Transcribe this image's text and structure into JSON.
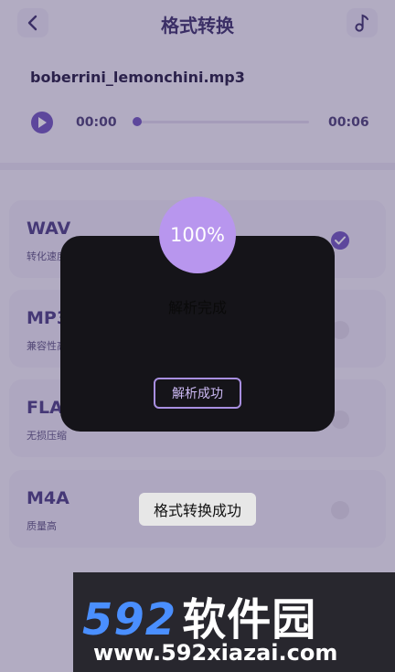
{
  "header": {
    "title": "格式转换",
    "back_icon": "chevron-left-icon",
    "music_icon": "music-note-icon"
  },
  "player": {
    "file_name": "boberrini_lemonchini.mp3",
    "current_time": "00:00",
    "total_time": "00:06",
    "progress": 0
  },
  "formats": [
    {
      "name": "WAV",
      "desc": "转化速度快",
      "selected": true
    },
    {
      "name": "MP3",
      "desc": "兼容性高",
      "selected": false
    },
    {
      "name": "FLAC",
      "desc": "无损压缩",
      "selected": false
    },
    {
      "name": "M4A",
      "desc": "质量高",
      "selected": false
    }
  ],
  "modal": {
    "percent": "100%",
    "message": "解析完成",
    "button_label": "解析成功"
  },
  "toast": {
    "message": "格式转换成功"
  },
  "watermark": {
    "brand_num": "592",
    "brand_cn": "软件园",
    "url": "www.592xiazai.com"
  },
  "colors": {
    "accent": "#6f54c0",
    "progress_circle": "#b896ee",
    "modal_bg": "#151419",
    "toast_bg": "#e7e7e7"
  }
}
